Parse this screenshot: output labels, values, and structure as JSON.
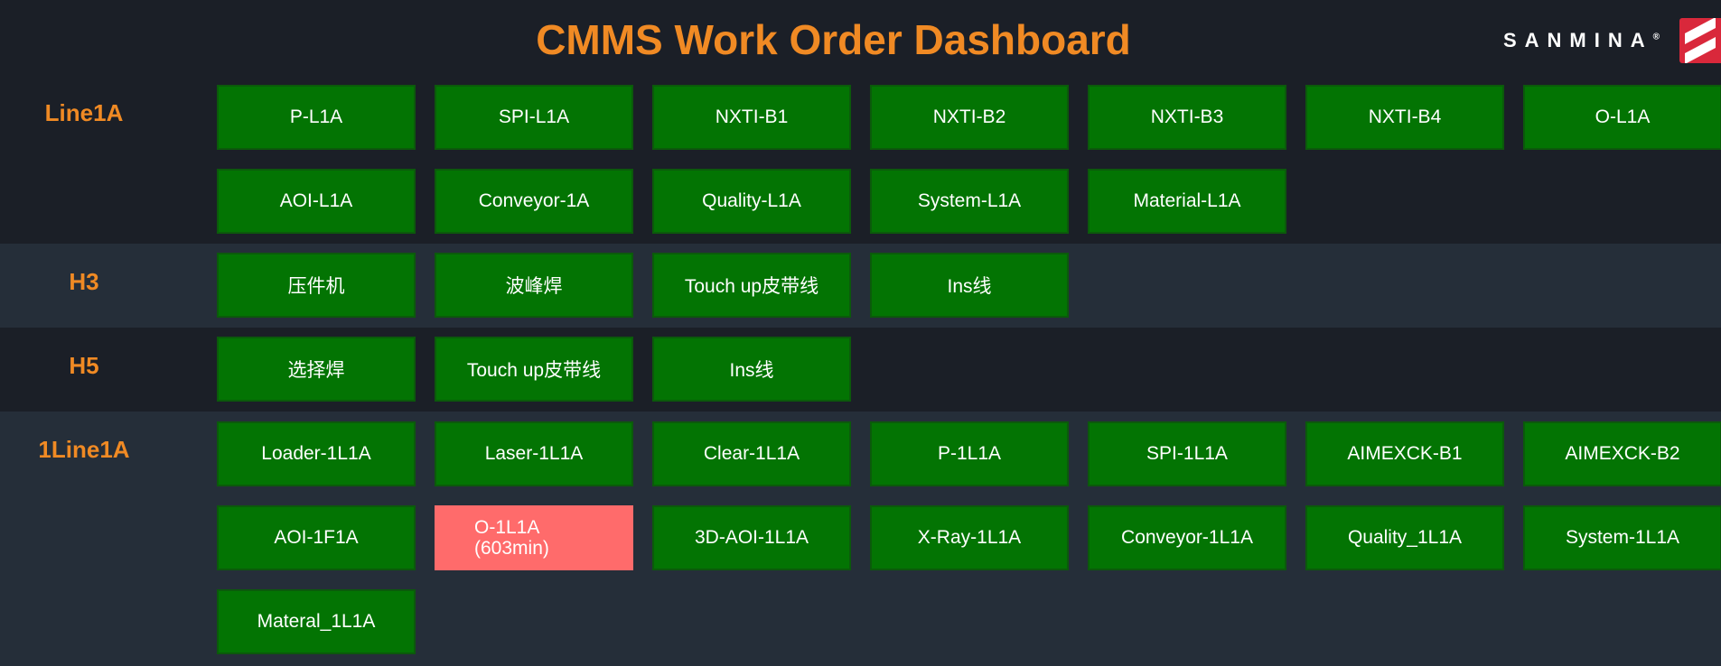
{
  "header": {
    "title": "CMMS Work Order Dashboard",
    "logo_text": "SANMINA",
    "logo_mark": "®",
    "colors": {
      "title": "#f08a24",
      "background": "#1b1f27",
      "tile_ok": "#037403",
      "tile_alert": "#ff6b6b",
      "logo": "#d9283b"
    }
  },
  "lines": [
    {
      "label": "Line1A",
      "tiles": [
        {
          "name": "P-L1A",
          "status": "ok"
        },
        {
          "name": "SPI-L1A",
          "status": "ok"
        },
        {
          "name": "NXTI-B1",
          "status": "ok"
        },
        {
          "name": "NXTI-B2",
          "status": "ok"
        },
        {
          "name": "NXTI-B3",
          "status": "ok"
        },
        {
          "name": "NXTI-B4",
          "status": "ok"
        },
        {
          "name": "O-L1A",
          "status": "ok"
        },
        {
          "name": "AOI-L1A",
          "status": "ok"
        },
        {
          "name": "Conveyor-1A",
          "status": "ok"
        },
        {
          "name": "Quality-L1A",
          "status": "ok"
        },
        {
          "name": "System-L1A",
          "status": "ok"
        },
        {
          "name": "Material-L1A",
          "status": "ok"
        }
      ]
    },
    {
      "label": "H3",
      "tiles": [
        {
          "name": "压件机",
          "status": "ok"
        },
        {
          "name": "波峰焊",
          "status": "ok"
        },
        {
          "name": "Touch up皮带线",
          "status": "ok"
        },
        {
          "name": "Ins线",
          "status": "ok"
        }
      ]
    },
    {
      "label": "H5",
      "tiles": [
        {
          "name": "选择焊",
          "status": "ok"
        },
        {
          "name": "Touch up皮带线",
          "status": "ok"
        },
        {
          "name": "Ins线",
          "status": "ok"
        }
      ]
    },
    {
      "label": "1Line1A",
      "tiles": [
        {
          "name": "Loader-1L1A",
          "status": "ok"
        },
        {
          "name": "Laser-1L1A",
          "status": "ok"
        },
        {
          "name": "Clear-1L1A",
          "status": "ok"
        },
        {
          "name": "P-1L1A",
          "status": "ok"
        },
        {
          "name": "SPI-1L1A",
          "status": "ok"
        },
        {
          "name": "AIMEXCK-B1",
          "status": "ok"
        },
        {
          "name": "AIMEXCK-B2",
          "status": "ok"
        },
        {
          "name": "AOI-1F1A",
          "status": "ok"
        },
        {
          "name": "O-1L1A",
          "status": "alert",
          "detail": "(603min)"
        },
        {
          "name": "3D-AOI-1L1A",
          "status": "ok"
        },
        {
          "name": "X-Ray-1L1A",
          "status": "ok"
        },
        {
          "name": "Conveyor-1L1A",
          "status": "ok"
        },
        {
          "name": "Quality_1L1A",
          "status": "ok"
        },
        {
          "name": "System-1L1A",
          "status": "ok"
        },
        {
          "name": "Materal_1L1A",
          "status": "ok"
        }
      ]
    }
  ]
}
